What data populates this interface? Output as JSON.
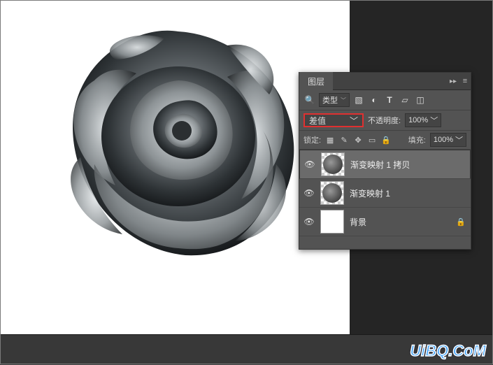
{
  "panel": {
    "title": "图层",
    "filter": {
      "search_icon": "🔍",
      "type_label": "类型",
      "icons": [
        "image-icon",
        "adjustment-icon",
        "text-icon",
        "path-icon",
        "smart-icon"
      ]
    },
    "blend": {
      "mode": "差值",
      "opacity_label": "不透明度:",
      "opacity_value": "100%"
    },
    "lock": {
      "label": "锁定:",
      "fill_label": "填充:",
      "fill_value": "100%"
    },
    "layers": [
      {
        "visible": true,
        "name": "渐变映射 1 拷贝",
        "selected": true,
        "locked": false,
        "thumb": "rose"
      },
      {
        "visible": true,
        "name": "渐变映射 1",
        "selected": false,
        "locked": false,
        "thumb": "rose"
      },
      {
        "visible": true,
        "name": "背景",
        "selected": false,
        "locked": true,
        "thumb": "white"
      }
    ]
  },
  "watermark": "UiBQ.CoM"
}
